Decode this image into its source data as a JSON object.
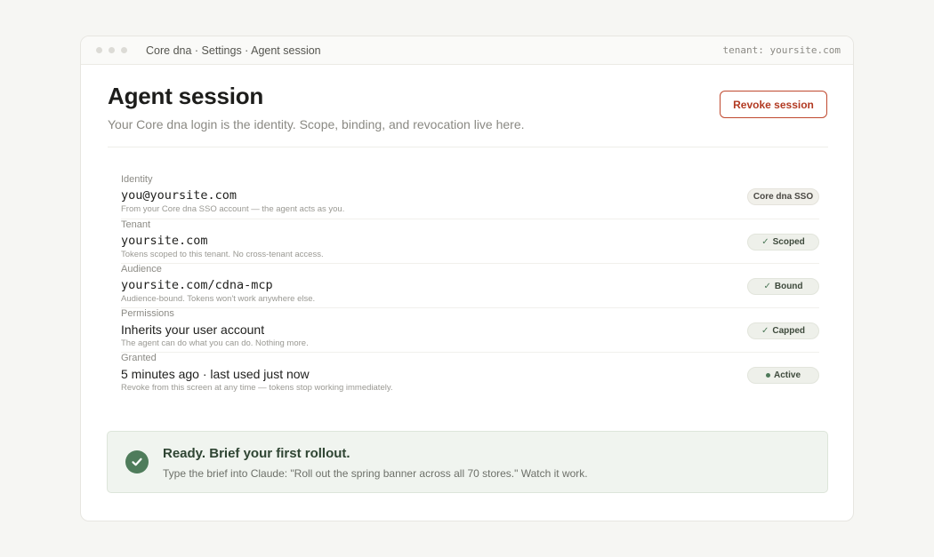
{
  "window": {
    "breadcrumb": "Core dna · Settings · Agent session",
    "tenant_label": "tenant: yoursite.com"
  },
  "header": {
    "title": "Agent session",
    "subtitle": "Your Core dna login is the identity. Scope, binding, and revocation live here.",
    "revoke_label": "Revoke session"
  },
  "rows": [
    {
      "label": "Identity",
      "value": "you@yoursite.com",
      "note": "From your Core dna SSO account — the agent acts as you.",
      "badge": "Core dna SSO"
    },
    {
      "label": "Tenant",
      "value": "yoursite.com",
      "note": "Tokens scoped to this tenant. No cross-tenant access.",
      "badge": "Scoped"
    },
    {
      "label": "Audience",
      "value": "yoursite.com/cdna-mcp",
      "note": "Audience-bound. Tokens won't work anywhere else.",
      "badge": "Bound"
    },
    {
      "label": "Permissions",
      "value": "Inherits your user account",
      "note": "The agent can do what you can do. Nothing more.",
      "badge": "Capped"
    },
    {
      "label": "Granted",
      "value": "5 minutes ago · last used just now",
      "note": "Revoke from this screen at any time — tokens stop working immediately.",
      "badge": "Active"
    }
  ],
  "ready": {
    "title": "Ready. Brief your first rollout.",
    "text": "Type the brief into Claude: \"Roll out the spring banner across all 70 stores.\" Watch it work."
  },
  "colors": {
    "accent_red": "#b23a22",
    "success_green": "#4f7c5b"
  }
}
